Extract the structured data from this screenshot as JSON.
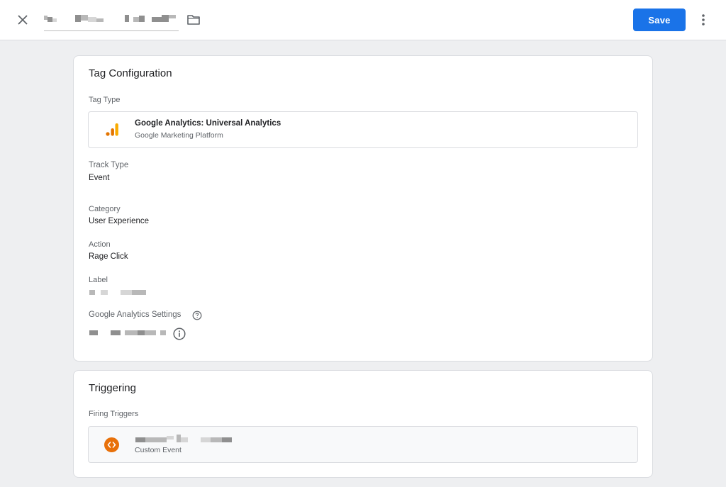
{
  "header": {
    "close_icon": "close-icon",
    "tag_name_redacted": true,
    "folder_icon": "folder-icon",
    "save_label": "Save",
    "more_icon": "more-vert-icon",
    "accent_color": "#1a73e8"
  },
  "tag_configuration": {
    "title": "Tag Configuration",
    "tag_type_label": "Tag Type",
    "tag_type": {
      "name": "Google Analytics: Universal Analytics",
      "provider": "Google Marketing Platform",
      "icon": "google-analytics-icon",
      "icon_color": "#f9ab00"
    },
    "fields": {
      "track_type": {
        "label": "Track Type",
        "value": "Event"
      },
      "category": {
        "label": "Category",
        "value": "User Experience"
      },
      "action": {
        "label": "Action",
        "value": "Rage Click"
      },
      "label": {
        "label": "Label"
      },
      "ga_settings": {
        "label": "Google Analytics Settings"
      }
    }
  },
  "triggering": {
    "title": "Triggering",
    "firing_triggers_label": "Firing Triggers",
    "trigger": {
      "type": "Custom Event",
      "icon": "custom-event-icon",
      "icon_color": "#e8710a"
    }
  }
}
